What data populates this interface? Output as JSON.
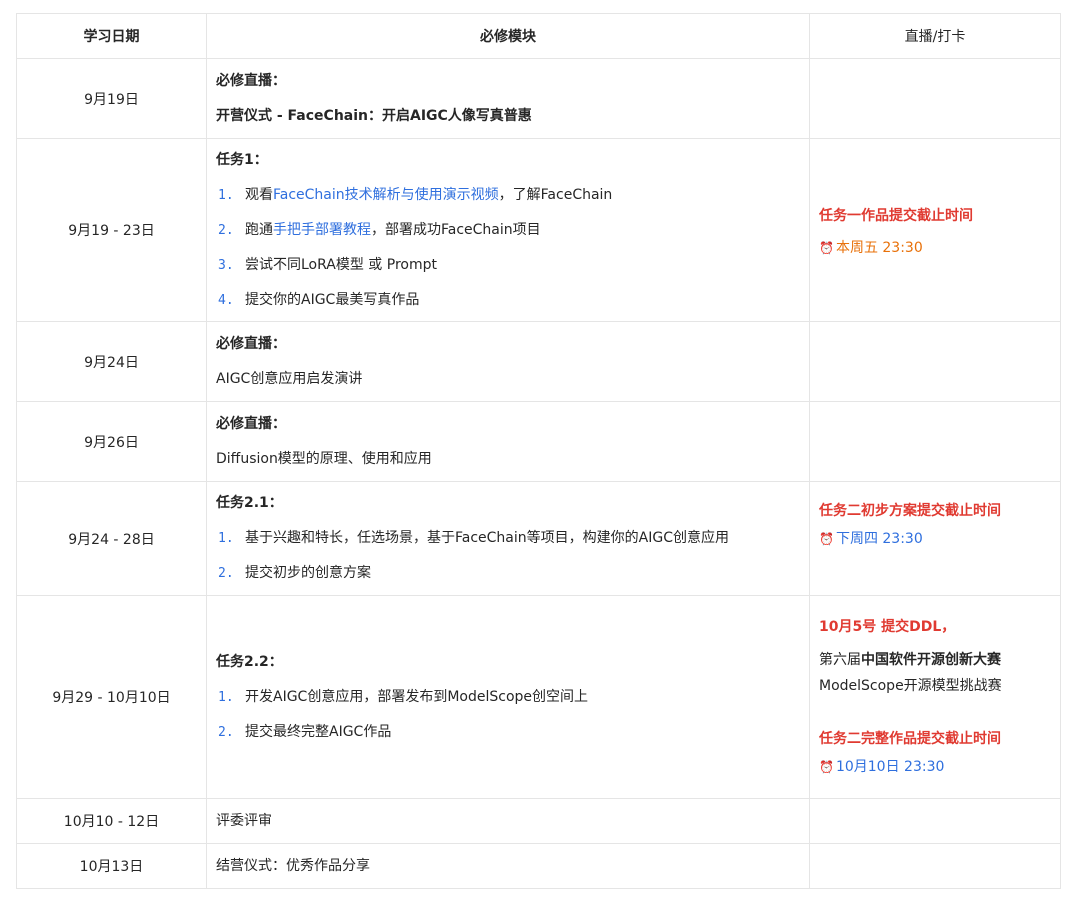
{
  "header": {
    "date": "学习日期",
    "module": "必修模块",
    "status": "直播/打卡"
  },
  "rows": [
    {
      "date": "9月19日",
      "title": "必修直播：",
      "desc": "开营仪式 - FaceChain：开启AIGC人像写真普惠"
    },
    {
      "date": "9月19 - 23日",
      "title": "任务1：",
      "tasks": [
        {
          "num": "1.",
          "pre": "观看",
          "link": "FaceChain技术解析与使用演示视频",
          "post": "，了解FaceChain"
        },
        {
          "num": "2.",
          "pre": "跑通",
          "link": "手把手部署教程",
          "post": "，部署成功FaceChain项目"
        },
        {
          "num": "3.",
          "text": "尝试不同LoRA模型 或 Prompt"
        },
        {
          "num": "4.",
          "text": "提交你的AIGC最美写真作品"
        }
      ],
      "status_title": "任务一作品提交截止时间",
      "status_icon": "alarm-clock-icon",
      "status_time": "本周五 23:30"
    },
    {
      "date": "9月24日",
      "title": "必修直播：",
      "desc": "AIGC创意应用启发演讲"
    },
    {
      "date": "9月26日",
      "title": "必修直播：",
      "desc": "Diffusion模型的原理、使用和应用"
    },
    {
      "date": "9月24 - 28日",
      "title": "任务2.1：",
      "tasks": [
        {
          "num": "1.",
          "text": "基于兴趣和特长，任选场景，基于FaceChain等项目，构建你的AIGC创意应用"
        },
        {
          "num": "2.",
          "text": "提交初步的创意方案"
        }
      ],
      "status_title": "任务二初步方案提交截止时间",
      "status_icon": "alarm-clock-icon",
      "status_time": "下周四 23:30"
    },
    {
      "date": "9月29 - 10月10日",
      "title": "任务2.2：",
      "tasks": [
        {
          "num": "1.",
          "text": "开发AIGC创意应用，部署发布到ModelScope创空间上"
        },
        {
          "num": "2.",
          "text": "提交最终完整AIGC作品"
        }
      ],
      "status_ddl": "10月5号 提交DDL，",
      "status_contest_prefix": "第六届",
      "status_contest_bold": "中国软件开源创新大赛",
      "status_contest_line2": "ModelScope开源模型挑战赛",
      "status_title": "任务二完整作品提交截止时间",
      "status_icon": "alarm-clock-icon",
      "status_time": "10月10日 23:30"
    },
    {
      "date": "10月10 - 12日",
      "desc": "评委评审"
    },
    {
      "date": "10月13日",
      "desc": "结营仪式：优秀作品分享"
    }
  ],
  "colors": {
    "red": "#e03a31",
    "blue_link": "#2f6fde",
    "orange": "#e8710a",
    "border": "#e5e5e5"
  }
}
